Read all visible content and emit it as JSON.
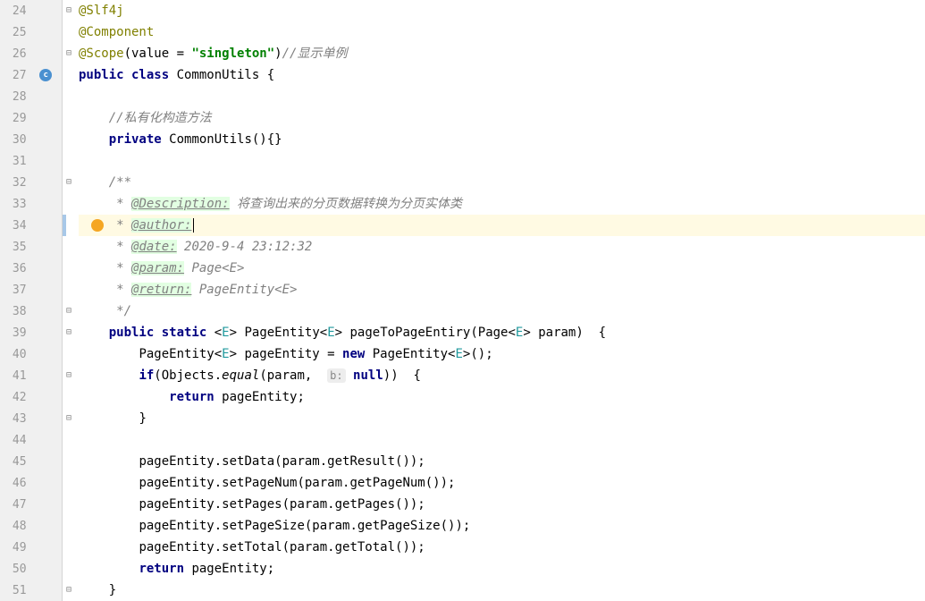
{
  "lines": [
    {
      "num": 24,
      "fold": "-",
      "tokens": [
        [
          "ann",
          "@Slf4j"
        ]
      ]
    },
    {
      "num": 25,
      "tokens": [
        [
          "ann",
          "@Component"
        ]
      ]
    },
    {
      "num": 26,
      "fold": "-",
      "tokens": [
        [
          "ann",
          "@Scope"
        ],
        [
          "",
          "(value = "
        ],
        [
          "str",
          "\"singleton\""
        ],
        [
          "",
          ")"
        ],
        [
          "comment",
          "//显示单例"
        ]
      ]
    },
    {
      "num": 27,
      "classIcon": true,
      "tokens": [
        [
          "kw",
          "public class "
        ],
        [
          "",
          "CommonUtils {"
        ]
      ]
    },
    {
      "num": 28,
      "tokens": []
    },
    {
      "num": 29,
      "indent": 1,
      "tokens": [
        [
          "comment",
          "//私有化构造方法"
        ]
      ]
    },
    {
      "num": 30,
      "indent": 1,
      "tokens": [
        [
          "kw",
          "private "
        ],
        [
          "",
          "CommonUtils(){}"
        ]
      ]
    },
    {
      "num": 31,
      "tokens": []
    },
    {
      "num": 32,
      "fold": "-",
      "indent": 1,
      "tokens": [
        [
          "doc-comment",
          "/**"
        ]
      ]
    },
    {
      "num": 33,
      "indent": 1,
      "tokens": [
        [
          "doc-comment",
          " * "
        ],
        [
          "doc-tag",
          "@Description:"
        ],
        [
          "doc-comment",
          " 将查询出来的分页数据转换为分页实体类"
        ]
      ]
    },
    {
      "num": 34,
      "highlighted": true,
      "modified": true,
      "bulb": true,
      "indent": 1,
      "tokens": [
        [
          "doc-comment",
          " * "
        ],
        [
          "doc-tag-hl",
          "@author:"
        ],
        [
          "cursor",
          ""
        ]
      ]
    },
    {
      "num": 35,
      "indent": 1,
      "tokens": [
        [
          "doc-comment",
          " * "
        ],
        [
          "doc-tag",
          "@date:"
        ],
        [
          "doc-comment",
          " 2020-9-4 23:12:32"
        ]
      ]
    },
    {
      "num": 36,
      "indent": 1,
      "tokens": [
        [
          "doc-comment",
          " * "
        ],
        [
          "doc-tag",
          "@param:"
        ],
        [
          "doc-comment",
          " Page<E>"
        ]
      ]
    },
    {
      "num": 37,
      "indent": 1,
      "tokens": [
        [
          "doc-comment",
          " * "
        ],
        [
          "doc-tag",
          "@return:"
        ],
        [
          "doc-comment",
          " PageEntity<E>"
        ]
      ]
    },
    {
      "num": 38,
      "fold": "-",
      "indent": 1,
      "tokens": [
        [
          "doc-comment",
          " */"
        ]
      ]
    },
    {
      "num": 39,
      "fold": "-",
      "indent": 1,
      "tokens": [
        [
          "kw",
          "public static "
        ],
        [
          "",
          "<"
        ],
        [
          "type-param",
          "E"
        ],
        [
          "",
          "> PageEntity<"
        ],
        [
          "type-param",
          "E"
        ],
        [
          "",
          "> pageToPageEntiry(Page<"
        ],
        [
          "type-param",
          "E"
        ],
        [
          "",
          "> param)  {"
        ]
      ]
    },
    {
      "num": 40,
      "indent": 2,
      "tokens": [
        [
          "",
          "PageEntity<"
        ],
        [
          "type-param",
          "E"
        ],
        [
          "",
          "> pageEntity = "
        ],
        [
          "kw",
          "new "
        ],
        [
          "",
          "PageEntity<"
        ],
        [
          "type-param",
          "E"
        ],
        [
          "",
          ">();"
        ]
      ]
    },
    {
      "num": 41,
      "fold": "-",
      "indent": 2,
      "tokens": [
        [
          "kw",
          "if"
        ],
        [
          "",
          "(Objects."
        ],
        [
          "method-static",
          "equal"
        ],
        [
          "",
          "(param,  "
        ],
        [
          "param-hint",
          "b:"
        ],
        [
          "",
          ""
        ],
        [
          "kw",
          " null"
        ],
        [
          "",
          "))  {"
        ]
      ]
    },
    {
      "num": 42,
      "indent": 3,
      "tokens": [
        [
          "kw",
          "return "
        ],
        [
          "",
          "pageEntity;"
        ]
      ]
    },
    {
      "num": 43,
      "fold": "-",
      "indent": 2,
      "tokens": [
        [
          "",
          "}"
        ]
      ]
    },
    {
      "num": 44,
      "tokens": []
    },
    {
      "num": 45,
      "indent": 2,
      "tokens": [
        [
          "",
          "pageEntity.setData(param.getResult());"
        ]
      ]
    },
    {
      "num": 46,
      "indent": 2,
      "tokens": [
        [
          "",
          "pageEntity.setPageNum(param.getPageNum());"
        ]
      ]
    },
    {
      "num": 47,
      "indent": 2,
      "tokens": [
        [
          "",
          "pageEntity.setPages(param.getPages());"
        ]
      ]
    },
    {
      "num": 48,
      "indent": 2,
      "tokens": [
        [
          "",
          "pageEntity.setPageSize(param.getPageSize());"
        ]
      ]
    },
    {
      "num": 49,
      "indent": 2,
      "tokens": [
        [
          "",
          "pageEntity.setTotal(param.getTotal());"
        ]
      ]
    },
    {
      "num": 50,
      "indent": 2,
      "tokens": [
        [
          "kw",
          "return "
        ],
        [
          "",
          "pageEntity;"
        ]
      ]
    },
    {
      "num": 51,
      "fold": "-",
      "indent": 1,
      "tokens": [
        [
          "",
          "}"
        ]
      ]
    }
  ],
  "indentUnit": "    ",
  "classIconLabel": "c"
}
